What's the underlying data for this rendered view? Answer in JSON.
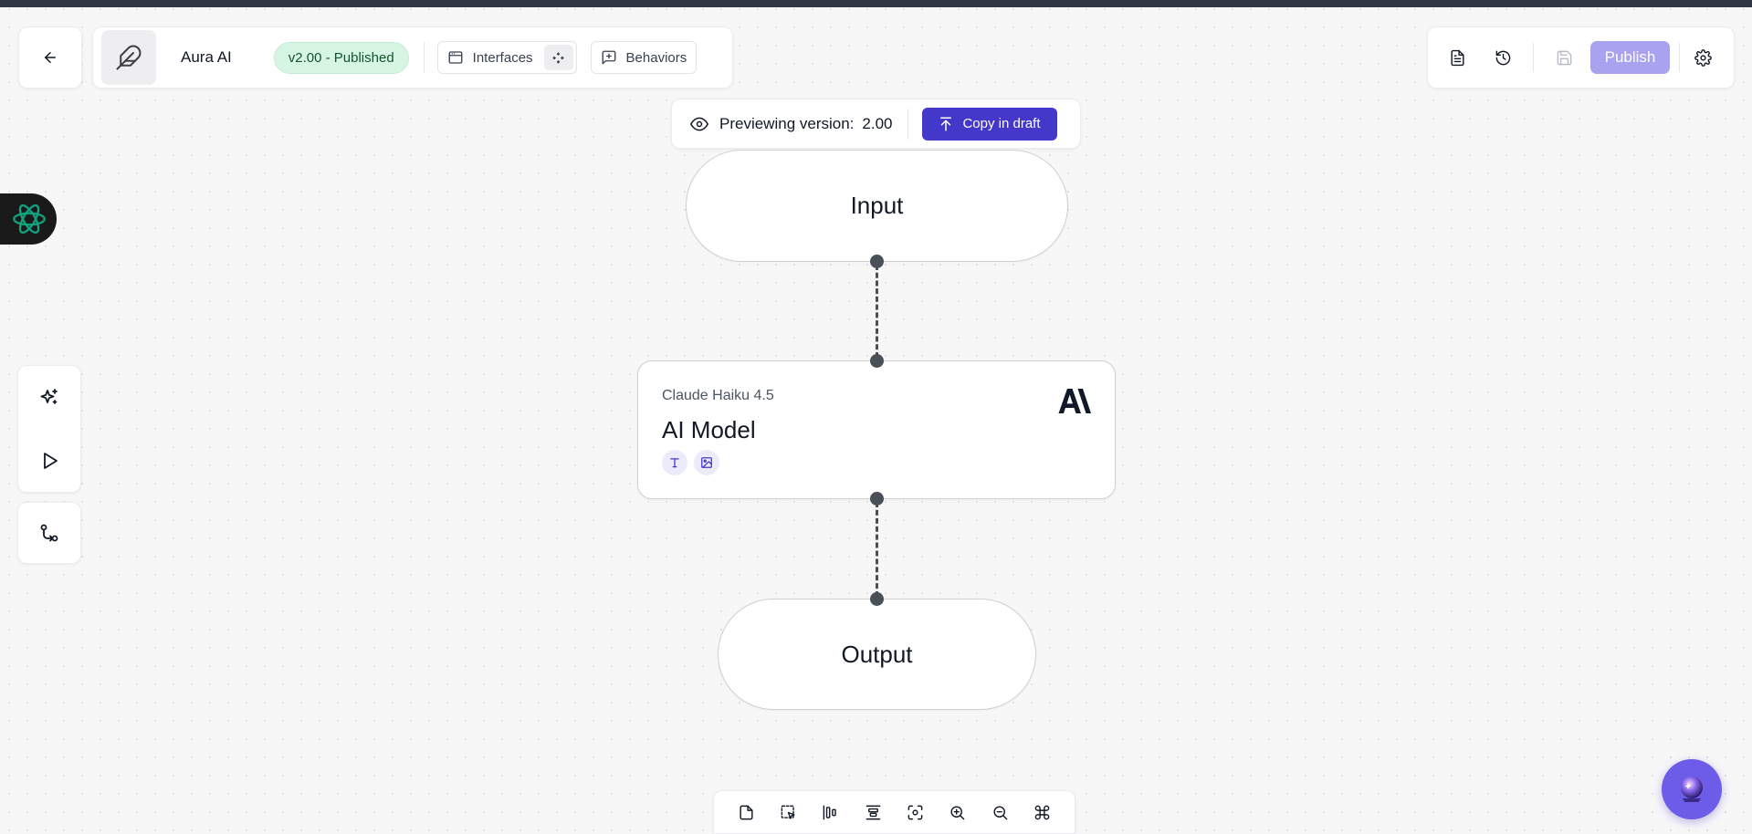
{
  "header": {
    "app_name": "Aura AI",
    "version_badge": "v2.00 - Published",
    "interfaces_label": "Interfaces",
    "behaviors_label": "Behaviors"
  },
  "actions": {
    "publish_label": "Publish"
  },
  "preview": {
    "label": "Previewing version:",
    "version": "2.00",
    "copy_label": "Copy in draft"
  },
  "flow": {
    "input_label": "Input",
    "output_label": "Output",
    "model_node": {
      "model_name": "Claude Haiku 4.5",
      "title": "AI Model",
      "capabilities": [
        "text-icon",
        "image-icon"
      ]
    }
  },
  "icons": {
    "back": "arrow-left-icon",
    "logo": "feather-icon",
    "assistant": "openai-logo-icon",
    "model_provider": "anthropic-logo-icon",
    "bottom_tools": [
      "page-icon",
      "select-icon",
      "align-horizontal-icon",
      "align-vertical-icon",
      "fit-view-icon",
      "zoom-in-icon",
      "zoom-out-icon",
      "command-icon"
    ]
  },
  "colors": {
    "accent": "#4338ca",
    "publish_disabled": "#a9a2ee",
    "badge_bg": "#d7f5e3",
    "badge_text": "#14532d",
    "fab": "#6d5ce8",
    "assistant_glyph": "#10a37f"
  }
}
